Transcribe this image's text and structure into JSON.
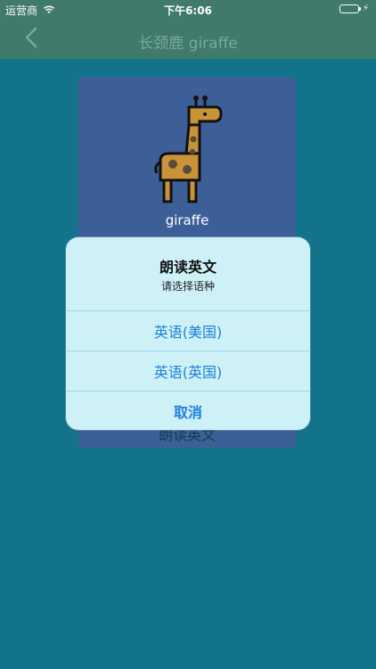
{
  "status_bar": {
    "carrier": "运营商",
    "time": "下午6:06",
    "wifi_icon": "wifi-icon",
    "battery_icon": "battery-icon"
  },
  "nav": {
    "title": "长颈鹿  giraffe",
    "back_icon": "chevron-left-icon"
  },
  "card": {
    "animal_name": "giraffe",
    "bottom_text": "朗读英文",
    "image_icon": "giraffe-icon"
  },
  "action_sheet": {
    "title": "朗读英文",
    "subtitle": "请选择语种",
    "options": [
      {
        "label": "英语(美国)"
      },
      {
        "label": "英语(英国)"
      }
    ],
    "cancel_label": "取消"
  },
  "colors": {
    "background": "#13738a",
    "nav_bar": "#3f7a6a",
    "card": "#3d5f97",
    "sheet": "#cef1f7",
    "action_text": "#1d7edb"
  }
}
